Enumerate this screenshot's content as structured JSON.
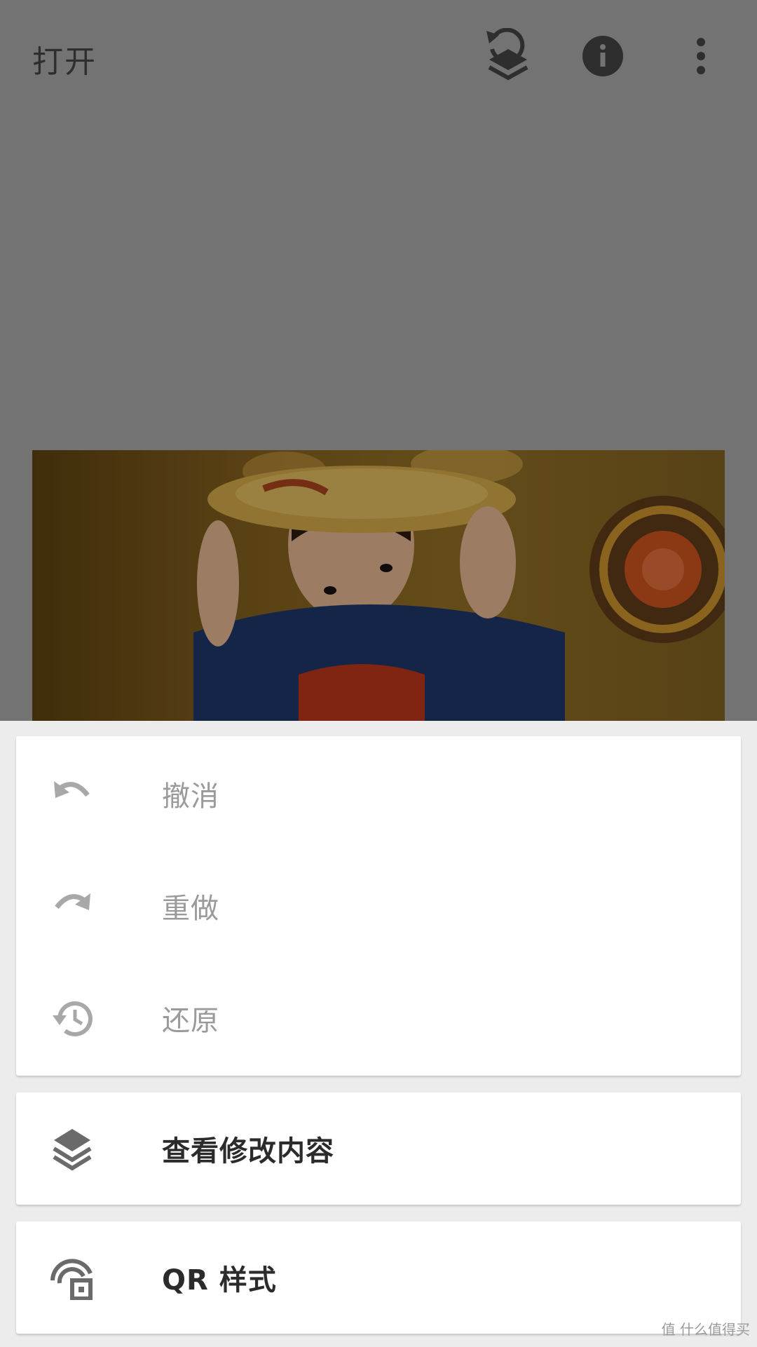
{
  "topbar": {
    "open_label": "打开",
    "icons": [
      "history-layers-icon",
      "info-icon",
      "more-vert-icon"
    ]
  },
  "photo": {
    "description_name": "photo-preview"
  },
  "menu": {
    "history_items": [
      {
        "label": "撤消",
        "icon": "undo-icon",
        "enabled": false
      },
      {
        "label": "重做",
        "icon": "redo-icon",
        "enabled": false
      },
      {
        "label": "还原",
        "icon": "restore-history-icon",
        "enabled": false
      }
    ],
    "view_changes": {
      "label": "查看修改内容",
      "icon": "layers-icon"
    },
    "qr_style": {
      "label": "QR 样式",
      "icon": "qr-style-icon"
    }
  },
  "watermark": "值 什么值得买",
  "colors": {
    "disabled_text": "#9a9a9a",
    "enabled_text": "#2b2b2b",
    "scrim": "#737373",
    "sheet": "#ececec"
  }
}
